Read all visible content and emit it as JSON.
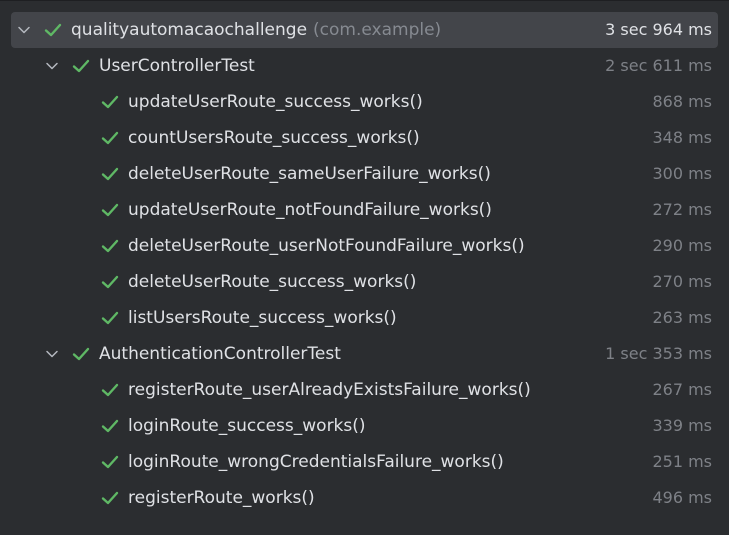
{
  "colors": {
    "background": "#2b2d30",
    "selection": "#43454a",
    "check": "#5fb865",
    "text": "#dfe1e5",
    "muted": "#7e8187"
  },
  "icons": {
    "expand": "chevron-down-icon",
    "passed": "check-icon"
  },
  "root": {
    "name": "qualityautomacaochallenge",
    "package": "(com.example)",
    "duration": "3 sec 964 ms"
  },
  "suites": [
    {
      "name": "UserControllerTest",
      "duration": "2 sec 611 ms",
      "tests": [
        {
          "name": "updateUserRoute_success_works()",
          "duration": "868 ms"
        },
        {
          "name": "countUsersRoute_success_works()",
          "duration": "348 ms"
        },
        {
          "name": "deleteUserRoute_sameUserFailure_works()",
          "duration": "300 ms"
        },
        {
          "name": "updateUserRoute_notFoundFailure_works()",
          "duration": "272 ms"
        },
        {
          "name": "deleteUserRoute_userNotFoundFailure_works()",
          "duration": "290 ms"
        },
        {
          "name": "deleteUserRoute_success_works()",
          "duration": "270 ms"
        },
        {
          "name": "listUsersRoute_success_works()",
          "duration": "263 ms"
        }
      ]
    },
    {
      "name": "AuthenticationControllerTest",
      "duration": "1 sec 353 ms",
      "tests": [
        {
          "name": "registerRoute_userAlreadyExistsFailure_works()",
          "duration": "267 ms"
        },
        {
          "name": "loginRoute_success_works()",
          "duration": "339 ms"
        },
        {
          "name": "loginRoute_wrongCredentialsFailure_works()",
          "duration": "251 ms"
        },
        {
          "name": "registerRoute_works()",
          "duration": "496 ms"
        }
      ]
    }
  ]
}
